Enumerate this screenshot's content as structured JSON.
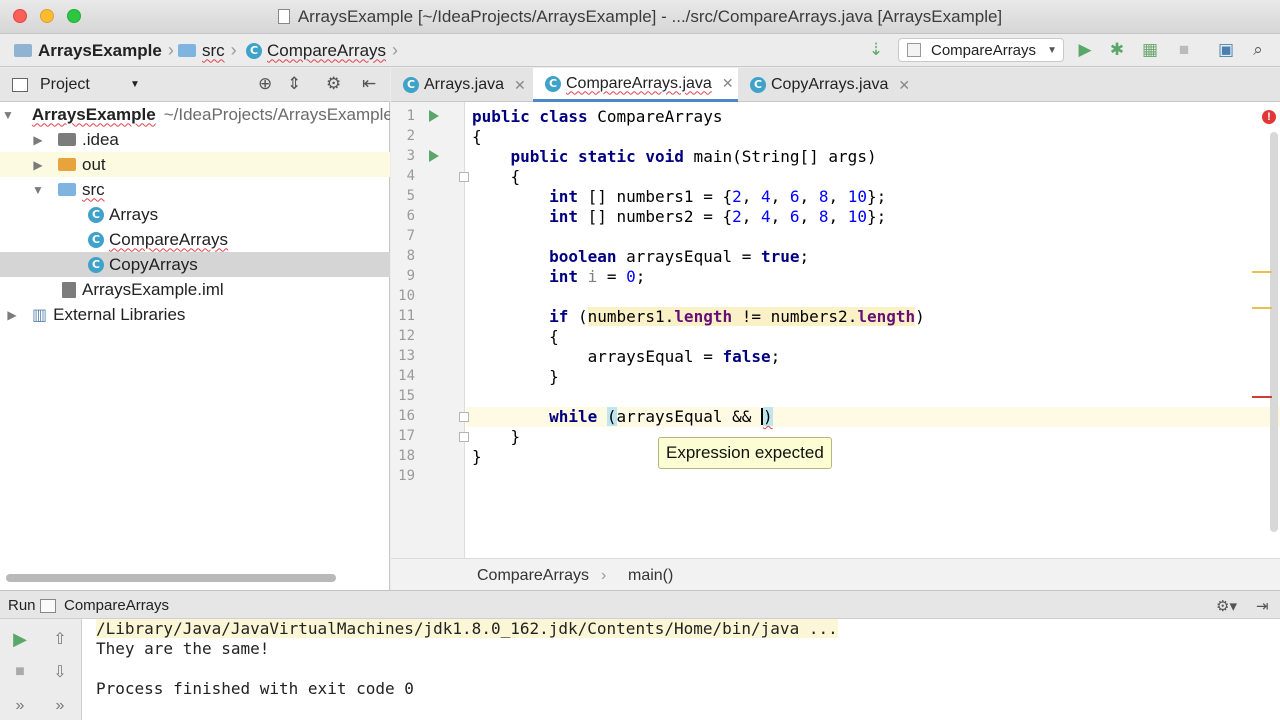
{
  "window": {
    "title": "ArraysExample [~/IdeaProjects/ArraysExample] - .../src/CompareArrays.java [ArraysExample]"
  },
  "navbar": {
    "crumbs": [
      "ArraysExample",
      "src",
      "CompareArrays"
    ],
    "run_config": "CompareArrays"
  },
  "project_panel": {
    "title": "Project",
    "tree": [
      {
        "label": "ArraysExample",
        "path": "~/IdeaProjects/ArraysExample"
      },
      {
        "label": ".idea"
      },
      {
        "label": "out"
      },
      {
        "label": "src"
      },
      {
        "label": "Arrays"
      },
      {
        "label": "CompareArrays"
      },
      {
        "label": "CopyArrays"
      },
      {
        "label": "ArraysExample.iml"
      },
      {
        "label": "External Libraries"
      }
    ]
  },
  "editor": {
    "tabs": [
      {
        "label": "Arrays.java"
      },
      {
        "label": "CompareArrays.java",
        "active": true
      },
      {
        "label": "CopyArrays.java"
      }
    ],
    "line_numbers": [
      "1",
      "2",
      "3",
      "4",
      "5",
      "6",
      "7",
      "8",
      "9",
      "10",
      "11",
      "12",
      "13",
      "14",
      "15",
      "16",
      "17",
      "18",
      "19"
    ],
    "code": {
      "l1_kw": "public class",
      "l1_rest": " CompareArrays",
      "l2": "{",
      "l3_kw": "public static void",
      "l3_rest": " main(String[] args)",
      "l4": "{",
      "l5_kw": "int",
      "l5_a": " [] numbers1 = {",
      "l5_n1": "2",
      "l5_n2": "4",
      "l5_n3": "6",
      "l5_n4": "8",
      "l5_n5": "10",
      "l5_end": "};",
      "l6_kw": "int",
      "l6_a": " [] numbers2 = {",
      "l6_n1": "2",
      "l6_n2": "4",
      "l6_n3": "6",
      "l6_n4": "8",
      "l6_n5": "10",
      "l6_end": "};",
      "l8_kw": "boolean",
      "l8_a": " arraysEqual = ",
      "l8_val": "true",
      "l8_end": ";",
      "l9_kw": "int",
      "l9_var": " i",
      "l9_a": " = ",
      "l9_num": "0",
      "l9_end": ";",
      "l11_kw": "if",
      "l11_a": " (",
      "l11_v1": "numbers1.",
      "l11_f1": "length",
      "l11_op": " != ",
      "l11_v2": "numbers2.",
      "l11_f2": "length",
      "l11_end": ")",
      "l12": "{",
      "l13_a": "arraysEqual = ",
      "l13_val": "false",
      "l13_end": ";",
      "l14": "}",
      "l16_kw": "while",
      "l16_sp": " ",
      "l16_open": "(",
      "l16_a": "arraysEqual && ",
      "l16_close": ")",
      "l17": "}",
      "l18": "}"
    },
    "tooltip": "Expression expected",
    "breadcrumb": [
      "CompareArrays",
      "main()"
    ]
  },
  "run_panel": {
    "title": "Run",
    "config": "CompareArrays",
    "console": [
      "/Library/Java/JavaVirtualMachines/jdk1.8.0_162.jdk/Contents/Home/bin/java ...",
      "They are the same!",
      "",
      "Process finished with exit code 0"
    ]
  },
  "colors": {
    "keyword": "#000080",
    "number": "#0000ff",
    "field": "#660e7a",
    "run_green": "#59a869",
    "error_red": "#e03737",
    "tab_underline": "#4a88c7"
  }
}
